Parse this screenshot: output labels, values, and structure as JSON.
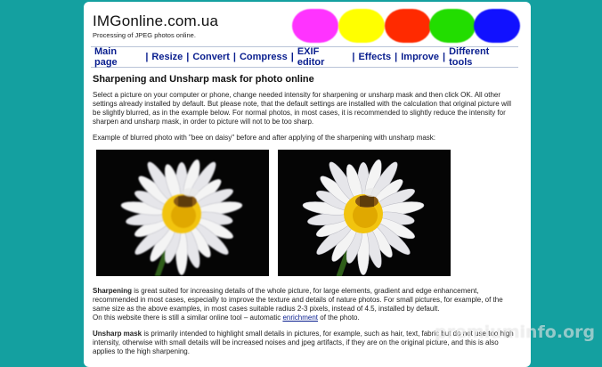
{
  "site": {
    "logo": "IMGonline.com.ua",
    "tagline": "Processing of JPEG photos online."
  },
  "nav": {
    "items": [
      "Main page",
      "Resize",
      "Convert",
      "Compress",
      "EXIF editor",
      "Effects",
      "Improve",
      "Different tools"
    ],
    "separator": "|"
  },
  "article": {
    "title": "Sharpening and Unsharp mask for photo online",
    "intro": "Select a picture on your computer or phone, change needed intensity for sharpening or unsharp mask and then click OK. All other settings already installed by default. But please note, that the default settings are installed with the calculation that original picture will be slightly blurred, as in the example below. For normal photos, in most cases, it is recommended to slightly reduce the intensity for sharpen and unsharp mask, in order to picture will not to be too sharp.",
    "example_caption": "Example of blurred photo with \"bee on daisy\" before and after applying of the sharpening with unsharp mask:",
    "sharpening_term": "Sharpening",
    "sharpening_text": " is great suited for increasing details of the whole picture, for large elements, gradient and edge enhancement, recommended in most cases, especially to improve the texture and details of nature photos. For small pictures, for example, of the same size as the above examples, in most cases suitable radius 2-3 pixels, instead of 4.5, installed by default.",
    "similar_text_before": "On this website there is still a similar online tool – automatic ",
    "similar_link": "enrichment",
    "similar_text_after": " of the photo.",
    "unsharp_term": "Unsharp mask",
    "unsharp_text": " is primarily intended to highlight small details in pictures, for example, such as hair, text, fabric but do not use too high intensity, otherwise with small details will be increased noises and jpeg artifacts, if they are on the original picture, and this is also applies to the high sharpening."
  },
  "watermark": "premiuminfo.org",
  "colors": {
    "background": "#14a0a0",
    "nav_link": "#0a1f8f",
    "blobs": [
      "#ff33ff",
      "#ffff00",
      "#ff2a00",
      "#22dd00",
      "#1111ff"
    ]
  }
}
